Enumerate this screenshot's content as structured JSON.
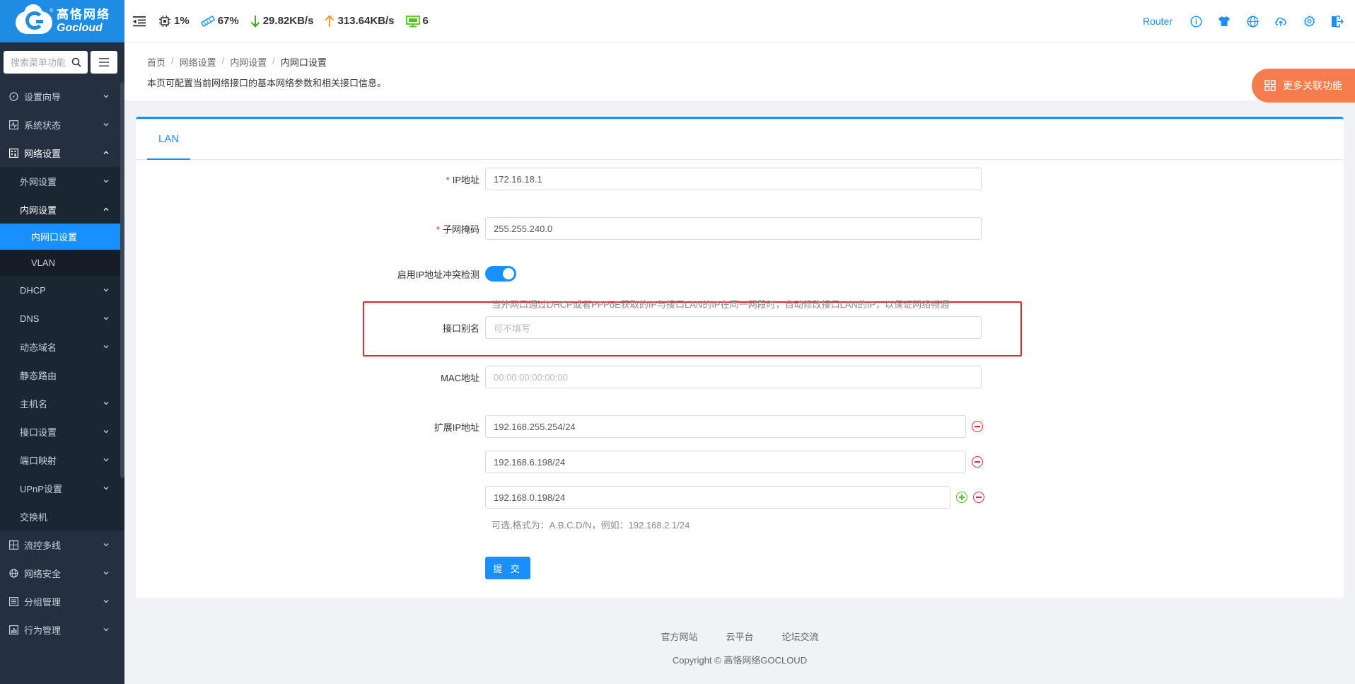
{
  "brand": {
    "cn": "高恪网络",
    "en": "Gocloud",
    "mark": "®"
  },
  "sidebar": {
    "search_placeholder": "搜索菜单功能",
    "items": [
      {
        "label": "设置向导",
        "icon": "compass-icon"
      },
      {
        "label": "系统状态",
        "icon": "pulse-icon"
      },
      {
        "label": "网络设置",
        "icon": "building-icon",
        "open": true
      }
    ],
    "network_sub": [
      {
        "label": "外网设置"
      },
      {
        "label": "内网设置",
        "open": true
      }
    ],
    "lan_sub": [
      {
        "label": "内网口设置",
        "active": true
      },
      {
        "label": "VLAN"
      }
    ],
    "network_sub_rest": [
      "DHCP",
      "DNS",
      "动态域名",
      "静态路由",
      "主机名",
      "接口设置",
      "端口映射",
      "UPnP设置",
      "交换机"
    ],
    "items_rest": [
      {
        "label": "流控多线",
        "icon": "grid-icon"
      },
      {
        "label": "网络安全",
        "icon": "globe-icon"
      },
      {
        "label": "分组管理",
        "icon": "list-icon"
      },
      {
        "label": "行为管理",
        "icon": "chart-icon"
      }
    ]
  },
  "header": {
    "cpu": "1%",
    "mem": "67%",
    "down": "29.82KB/s",
    "up": "313.64KB/s",
    "devices": "6",
    "router_label": "Router"
  },
  "page": {
    "breadcrumb": [
      "首页",
      "网络设置",
      "内网设置",
      "内网口设置"
    ],
    "description": "本页可配置当前网络接口的基本网络参数和相关接口信息。",
    "more_button": "更多关联功能"
  },
  "tab": "LAN",
  "form": {
    "ip_label": "IP地址",
    "ip_value": "172.16.18.1",
    "mask_label": "子网掩码",
    "mask_value": "255.255.240.0",
    "conflict_label": "启用IP地址冲突检测",
    "conflict_enabled": true,
    "conflict_hint": "当外网口通过DHCP或者PPPoE获取的IP与接口LAN的IP在同一网段时，自动修改接口LAN的IP，以保证网络畅通",
    "alias_label": "接口别名",
    "alias_placeholder": "可不填写",
    "mac_label": "MAC地址",
    "mac_placeholder": "00:00:00:00:00:00",
    "ext_label": "扩展IP地址",
    "ext_ips": [
      "192.168.255.254/24",
      "192.168.6.198/24",
      "192.168.0.198/24"
    ],
    "ext_hint": "可选,格式为：A.B.C.D/N，例如：192.168.2.1/24",
    "submit": "提 交"
  },
  "footer": {
    "links": [
      "官方网站",
      "云平台",
      "论坛交流"
    ],
    "copyright": "Copyright © 高恪网络GOCLOUD"
  }
}
